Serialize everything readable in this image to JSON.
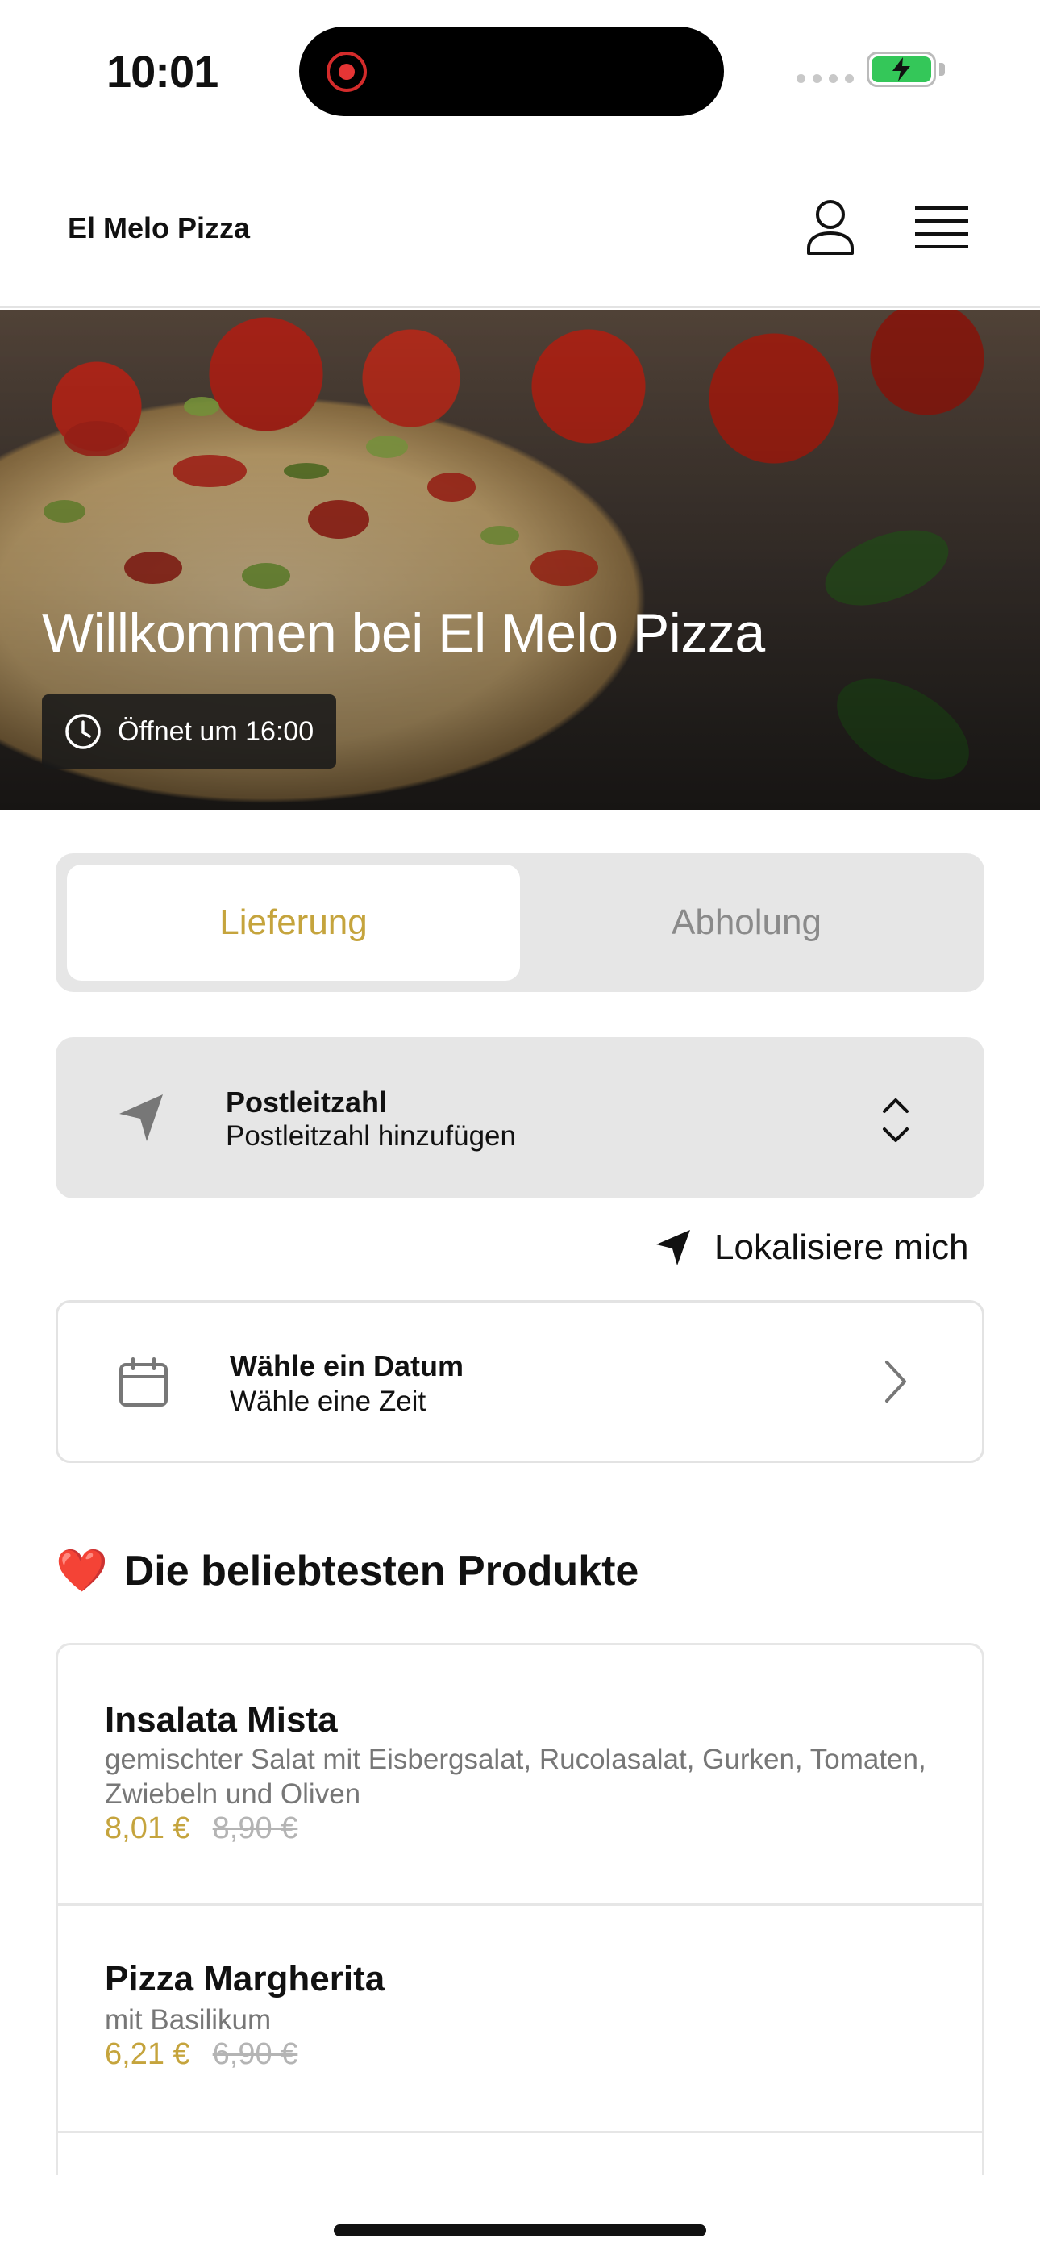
{
  "status_bar": {
    "time": "10:01"
  },
  "header": {
    "brand": "El Melo Pizza"
  },
  "hero": {
    "title": "Willkommen bei El Melo Pizza",
    "opening": "Öffnet um 16:00"
  },
  "delivery_mode": {
    "options": [
      "Lieferung",
      "Abholung"
    ],
    "selected": "Lieferung"
  },
  "postcode": {
    "title": "Postleitzahl",
    "placeholder": "Postleitzahl hinzufügen"
  },
  "locate": {
    "label": "Lokalisiere mich"
  },
  "schedule": {
    "title": "Wähle ein Datum",
    "subtitle": "Wähle eine Zeit"
  },
  "popular": {
    "emoji": "❤️",
    "title": "Die beliebtesten Produkte",
    "products": [
      {
        "name": "Insalata Mista",
        "description": "gemischter Salat mit Eisbergsalat, Rucolasalat, Gurken, Tomaten, Zwiebeln und Oliven",
        "price": "8,01 €",
        "old_price": "8,90 €"
      },
      {
        "name": "Pizza Margherita",
        "description": "mit Basilikum",
        "price": "6,21 €",
        "old_price": "6,90 €"
      }
    ]
  },
  "colors": {
    "accent": "#c5a43d",
    "card_bg": "#e6e6e6",
    "border": "#e3e3e3"
  }
}
